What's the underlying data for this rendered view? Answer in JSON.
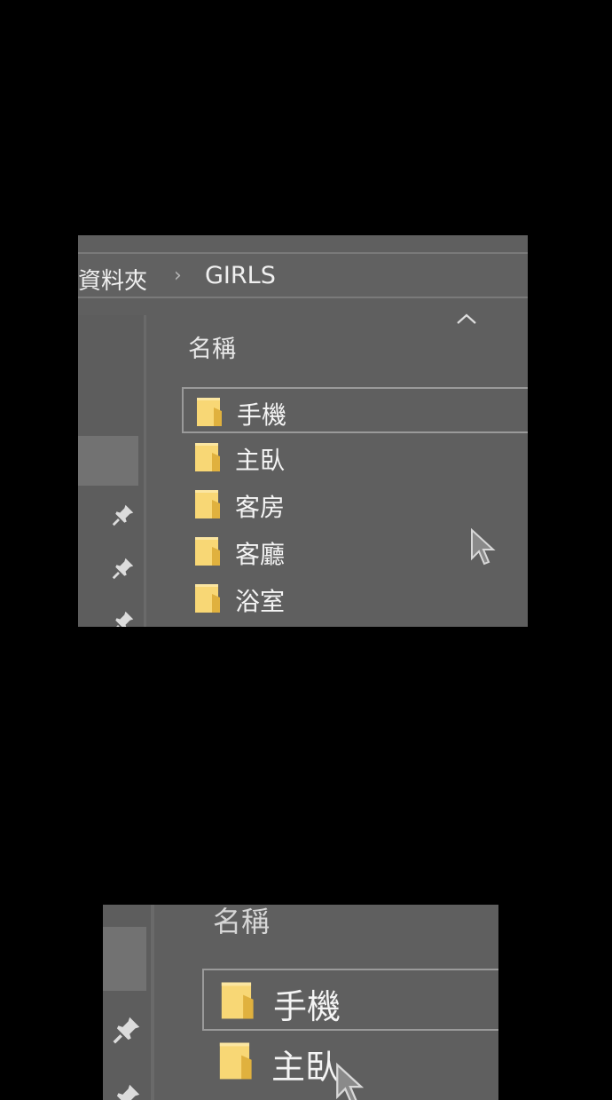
{
  "breadcrumb": {
    "parent": "資料夾",
    "separator": "›",
    "current": "GIRLS"
  },
  "column_header": {
    "name": "名稱",
    "sort_icon": "chevron-up-icon"
  },
  "files": [
    {
      "name": "手機",
      "icon": "folder-icon",
      "selected": true
    },
    {
      "name": "主臥",
      "icon": "folder-icon",
      "selected": false
    },
    {
      "name": "客房",
      "icon": "folder-icon",
      "selected": false
    },
    {
      "name": "客廳",
      "icon": "folder-icon",
      "selected": false
    },
    {
      "name": "浴室",
      "icon": "folder-icon",
      "selected": false
    }
  ],
  "zoom_view": {
    "column_header": "名稱",
    "files": [
      "手機",
      "主臥"
    ]
  },
  "colors": {
    "pane_background": "#5f5f5f",
    "folder_yellow": "#f8d775",
    "selection_border": "#9a9a9a"
  }
}
